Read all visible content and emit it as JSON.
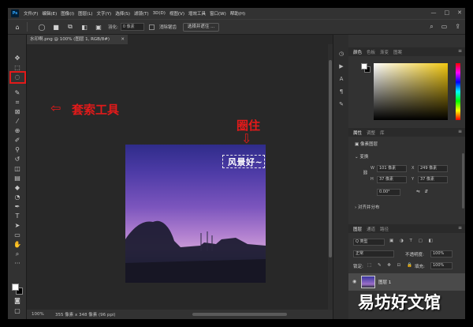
{
  "app": {
    "logo": "Ps",
    "menus": [
      "文件(F)",
      "编辑(E)",
      "图像(I)",
      "图层(L)",
      "文字(Y)",
      "选择(S)",
      "滤镜(T)",
      "3D(D)",
      "视图(V)",
      "增效工具",
      "窗口(W)",
      "帮助(H)"
    ],
    "window_controls": {
      "minimize": "—",
      "maximize": "□",
      "close": "✕"
    }
  },
  "options": {
    "feather_label": "羽化:",
    "feather_value": "0 像素",
    "antialias_label": "消除锯齿",
    "select_button": "选择并遮住 ..."
  },
  "document": {
    "tab_title": "水印啊.png @ 100% (图层 1, RGB/8#)",
    "tab_close": "✕",
    "photo_caption": "风景好~"
  },
  "annotations": {
    "lasso_tool": "套索工具",
    "enclose": "圈住",
    "arrow_left": "⇦",
    "arrow_down": "⇩"
  },
  "status": {
    "zoom": "100%",
    "info": "355 像素 x 348 像素 (96 ppi)"
  },
  "panels": {
    "color_tabs": [
      "颜色",
      "色板",
      "渐变",
      "图案"
    ],
    "properties_tabs": [
      "属性",
      "调整",
      "库"
    ],
    "properties_doc": "像素图层",
    "transform_heading": "变换",
    "transform": {
      "w_label": "W",
      "w_value": "101 像素",
      "x_label": "X",
      "x_value": "249 像素",
      "h_label": "H",
      "h_value": "37 像素",
      "y_label": "Y",
      "y_value": "37 像素",
      "angle": "0.00°"
    },
    "align_heading": "对齐并分布",
    "layers_tabs": [
      "图层",
      "通道",
      "路径"
    ],
    "layer_filter": "Q 类型",
    "blend_mode": "正常",
    "opacity_label": "不透明度:",
    "opacity_value": "100%",
    "lock_label": "锁定:",
    "fill_label": "填充:",
    "fill_value": "100%",
    "layer_name": "图层 1"
  },
  "watermark": "易坊好文馆",
  "colors": {
    "accent_red": "#e21a1a",
    "app_bg": "#282828",
    "panel_bg": "#323232"
  }
}
